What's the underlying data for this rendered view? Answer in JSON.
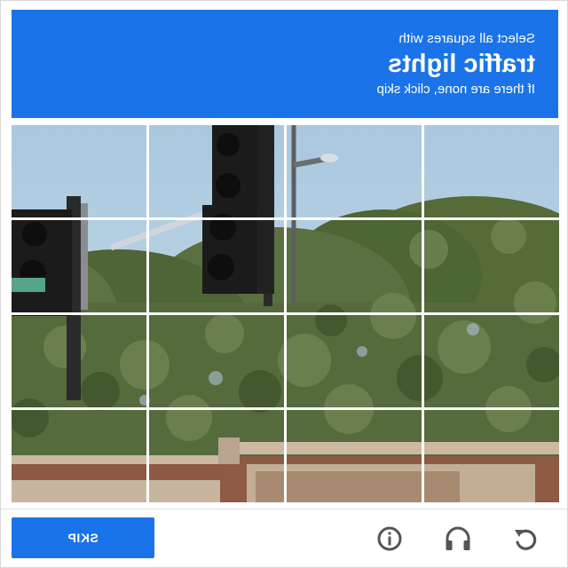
{
  "header": {
    "prompt_line": "Select all squares with",
    "target": "traffic lights",
    "instruction": "If there are none, click skip"
  },
  "footer": {
    "skip_label": "SKIP",
    "icons": [
      "info-icon",
      "headphones-audio-icon",
      "reload-icon"
    ]
  },
  "colors": {
    "accent": "#1a73e8",
    "icon": "#555555"
  },
  "grid": {
    "rows": 4,
    "columns": 4
  }
}
